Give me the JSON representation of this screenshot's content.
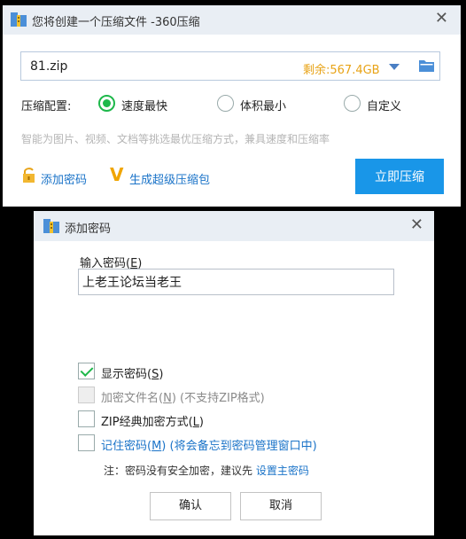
{
  "compress_window": {
    "title": "您将创建一个压缩文件 -360压缩",
    "close_glyph": "✕",
    "file_name": "81.zip",
    "free_space": "剩余:567.4GB",
    "config_label": "压缩配置:",
    "options": [
      {
        "label": "速度最快",
        "selected": true
      },
      {
        "label": "体积最小",
        "selected": false
      },
      {
        "label": "自定义",
        "selected": false
      }
    ],
    "hint": "智能为图片、视频、文档等挑选最优压缩方式，兼具速度和压缩率",
    "add_password": "添加密码",
    "super_pack": "生成超级压缩包",
    "compress_button": "立即压缩",
    "colors": {
      "accent": "#1996e8",
      "green": "#1db84a",
      "link": "#1a73c8",
      "free_space": "#e8a316"
    }
  },
  "password_dialog": {
    "title": "添加密码",
    "close_glyph": "✕",
    "input_label": "输入密码(",
    "input_label_key": "E",
    "input_label_end": ")",
    "password_value": "上老王论坛当老王",
    "show_password": {
      "label": "显示密码(",
      "key": "S",
      "end": ")",
      "checked": true
    },
    "encrypt_names": {
      "label": "加密文件名(",
      "key": "N",
      "end": ") (不支持ZIP格式)",
      "checked": false,
      "disabled": true
    },
    "zip_classic": {
      "label": "ZIP经典加密方式(",
      "key": "L",
      "end": ")",
      "checked": false
    },
    "remember": {
      "label": "记住密码(",
      "key": "M",
      "end": ") (将会备忘到密码管理窗口中)",
      "checked": false
    },
    "note_text": "注：密码没有安全加密，建议先 ",
    "note_link": "设置主密码",
    "ok_button": "确认",
    "cancel_button": "取消"
  }
}
